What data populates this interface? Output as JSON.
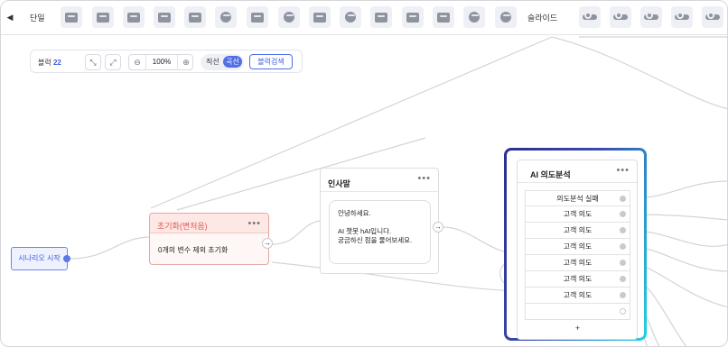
{
  "toolbar": {
    "collapse_icon": "caret-left-icon",
    "single_label": "단일",
    "single_tools": [
      {
        "icon": "card-icon"
      },
      {
        "icon": "image-icon"
      },
      {
        "icon": "image-text-icon"
      },
      {
        "icon": "grid-icon"
      },
      {
        "icon": "image-card-icon"
      },
      {
        "icon": "video-icon"
      },
      {
        "icon": "list-icon"
      },
      {
        "icon": "web-icon"
      },
      {
        "icon": "url-icon"
      },
      {
        "icon": "api-icon"
      },
      {
        "icon": "form-icon"
      },
      {
        "icon": "profile-card-icon"
      },
      {
        "icon": "image-output-icon"
      },
      {
        "icon": "api-settings-icon"
      },
      {
        "icon": "refresh-icon"
      }
    ],
    "slide_label": "슬라이드",
    "slide_tools": [
      {
        "icon": "slide-card-icon"
      },
      {
        "icon": "slide-image-icon"
      },
      {
        "icon": "slide-grid-icon"
      },
      {
        "icon": "slide-video-icon"
      },
      {
        "icon": "slide-list-icon"
      }
    ]
  },
  "controls": {
    "block_label": "블럭",
    "block_count": "22",
    "info_icon": "i",
    "shrink_icon": "⤡",
    "expand_icon": "⤢",
    "zoom_out": "⊖",
    "zoom_value": "100%",
    "zoom_in": "⊕",
    "line_straight": "직선",
    "line_curve": "곡선",
    "find_button": "블럭검색"
  },
  "nodes": {
    "start": {
      "label": "시나리오 시작"
    },
    "init": {
      "title": "초기화(변수 설정)",
      "title_visible": "초기화(변처음)",
      "body": "0개의 변수 제외 초기화",
      "more": "•••",
      "arrow": "→"
    },
    "greeting": {
      "title": "인사말",
      "more": "•••",
      "arrow": "→",
      "message_lines": [
        "안녕하세요.",
        "",
        "AI 챗봇 hAI입니다.",
        "궁금하신 점을 물어보세요."
      ]
    },
    "intent": {
      "title": "AI 의도분석",
      "more": "•••",
      "options": [
        {
          "label": "의도분석 실패"
        },
        {
          "label": "고객 의도"
        },
        {
          "label": "고객 의도"
        },
        {
          "label": "고객 의도"
        },
        {
          "label": "고객 의도"
        },
        {
          "label": "고객 의도"
        },
        {
          "label": "고객 의도"
        },
        {
          "label": ""
        }
      ],
      "add_label": "+"
    }
  },
  "colors": {
    "accent": "#4f6ee8",
    "init_border": "#e6a7a1",
    "init_title": "#e0594e",
    "highlight_start": "#2a2f8f",
    "highlight_end": "#1fd3df"
  }
}
